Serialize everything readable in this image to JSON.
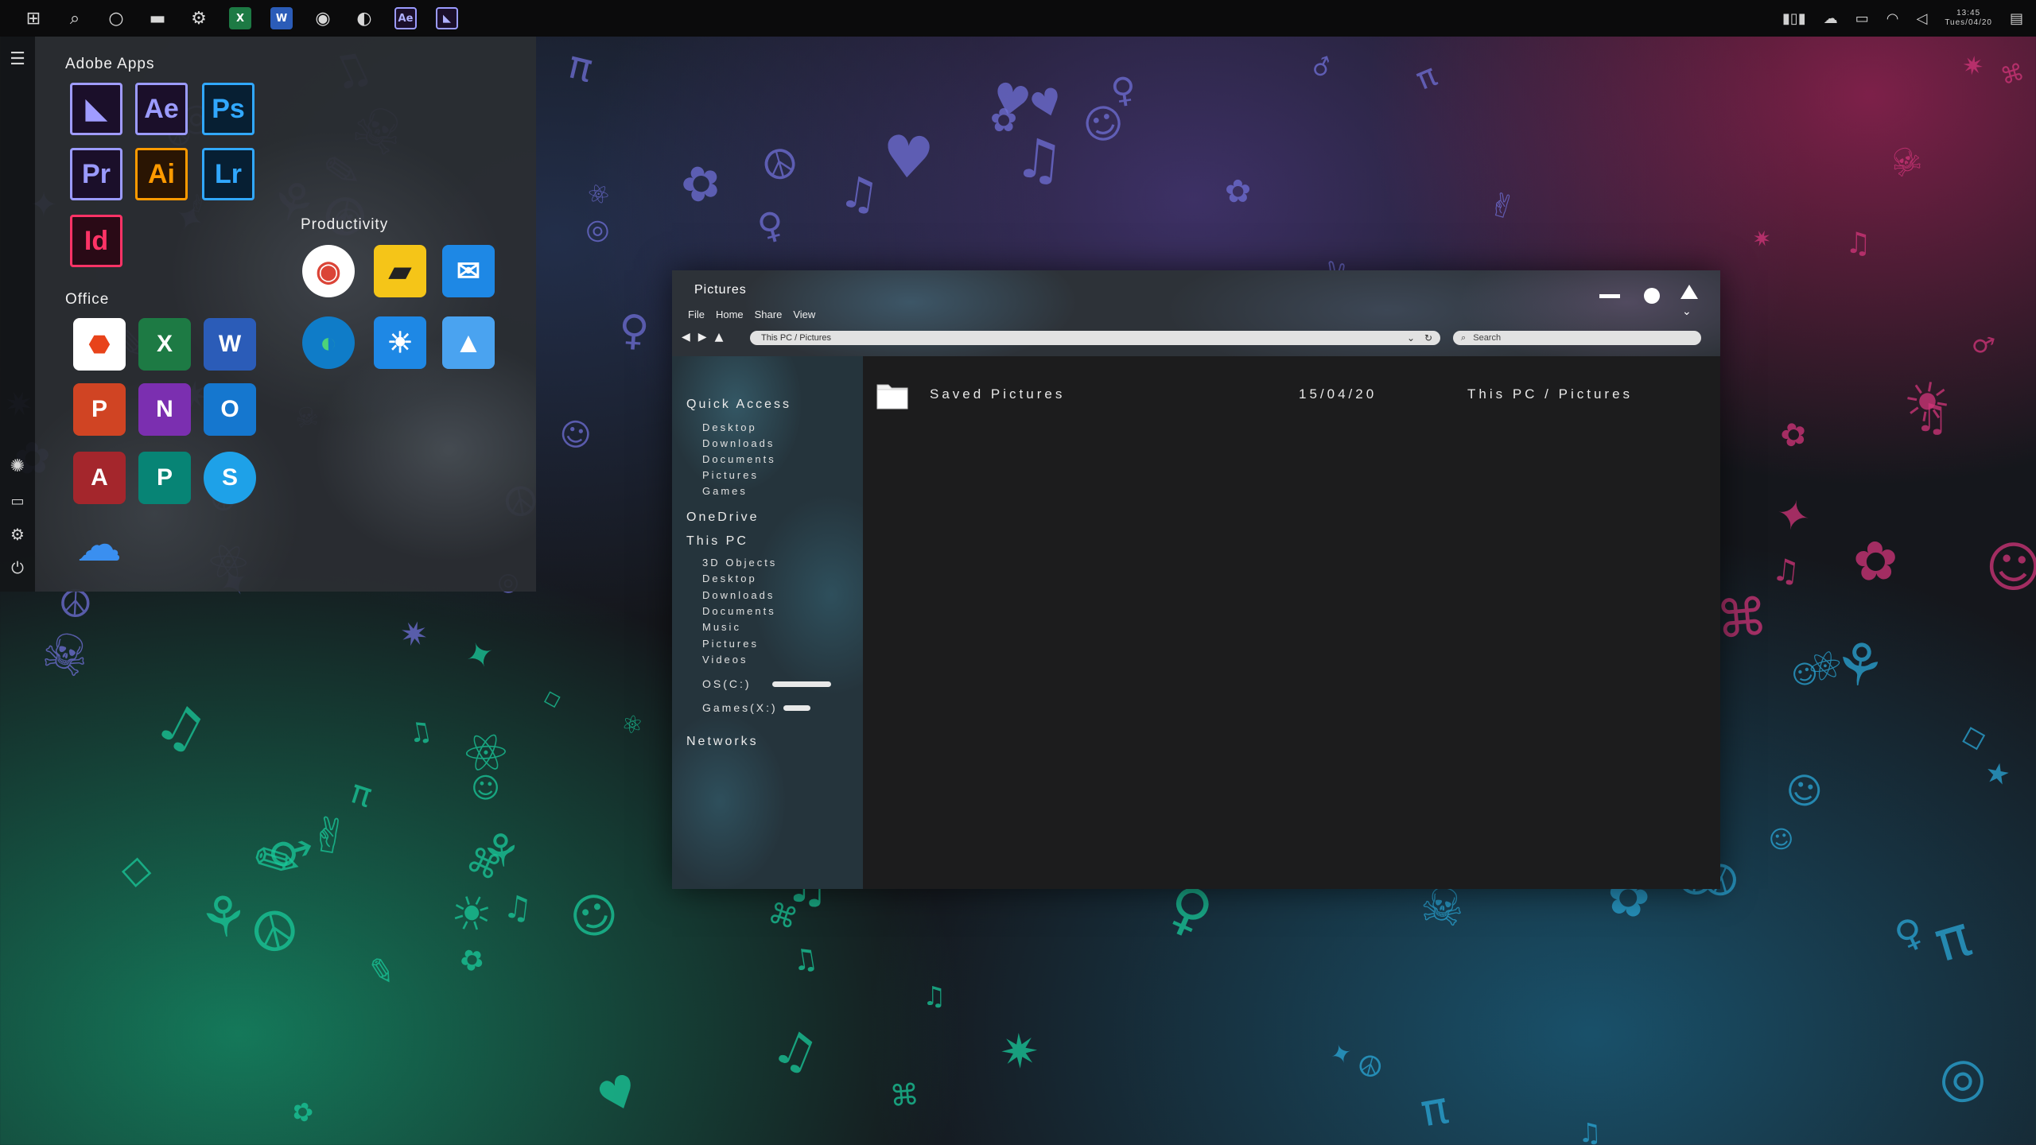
{
  "taskbar": {
    "pinned": [
      {
        "name": "windows-start-icon",
        "glyph": "⊞"
      },
      {
        "name": "search-icon",
        "glyph": "⌕"
      },
      {
        "name": "cortana-icon",
        "glyph": "○"
      },
      {
        "name": "file-explorer-icon",
        "glyph": "▬"
      },
      {
        "name": "settings-icon",
        "glyph": "⚙"
      },
      {
        "name": "excel-icon",
        "tile": "X",
        "color": "#1d7a44"
      },
      {
        "name": "word-icon",
        "tile": "W",
        "color": "#2b5cb8"
      },
      {
        "name": "chrome-icon",
        "glyph": "◉"
      },
      {
        "name": "app-icon",
        "glyph": "◐"
      },
      {
        "name": "after-effects-icon",
        "tile": "Ae",
        "color": "#1b0f2a"
      },
      {
        "name": "premiere-rush-icon",
        "tile": "◣",
        "color": "#1b0f2a"
      }
    ],
    "tray": {
      "clock_time": "13:45",
      "clock_date": "Tues/04/20"
    }
  },
  "start_menu": {
    "adobe_title": "Adobe Apps",
    "office_title": "Office",
    "productivity_title": "Productivity",
    "adobe_apps": [
      {
        "label": "◣",
        "name": "premiere-rush-tile",
        "color": "#a09cff"
      },
      {
        "label": "Ae",
        "name": "after-effects-tile",
        "color": "#9b9bff"
      },
      {
        "label": "Ps",
        "name": "photoshop-tile",
        "color": "#31a8ff"
      },
      {
        "label": "Pr",
        "name": "premiere-pro-tile",
        "color": "#9b9bff"
      },
      {
        "label": "Ai",
        "name": "illustrator-tile",
        "color": "#ff9a00"
      },
      {
        "label": "Lr",
        "name": "lightroom-tile",
        "color": "#31a8ff"
      },
      {
        "label": "Id",
        "name": "indesign-tile",
        "color": "#ff3366"
      }
    ],
    "office_apps": [
      {
        "label": "⬣",
        "name": "office-tile",
        "color": "#ffffff",
        "fg": "#e8431a"
      },
      {
        "label": "X",
        "name": "excel-tile",
        "color": "#1d7a44"
      },
      {
        "label": "W",
        "name": "word-tile",
        "color": "#2b5cb8"
      },
      {
        "label": "P",
        "name": "powerpoint-tile",
        "color": "#d04423"
      },
      {
        "label": "N",
        "name": "onenote-tile",
        "color": "#7b2fb0"
      },
      {
        "label": "O",
        "name": "outlook-tile",
        "color": "#1577cf"
      },
      {
        "label": "A",
        "name": "access-tile",
        "color": "#a4262c"
      },
      {
        "label": "P",
        "name": "publisher-tile",
        "color": "#078475"
      },
      {
        "label": "S",
        "name": "skype-tile",
        "color": "#1ea1e8"
      },
      {
        "label": "☁",
        "name": "onedrive-tile",
        "color": "#2b7de9"
      }
    ],
    "productivity_apps": [
      {
        "label": "◉",
        "name": "chrome-tile",
        "color": "#ffffff",
        "fg": "#db4437"
      },
      {
        "label": "▰",
        "name": "sticky-notes-tile",
        "color": "#f5c518",
        "fg": "#222222"
      },
      {
        "label": "✉",
        "name": "mail-tile",
        "color": "#1e88e5",
        "fg": "#ffffff"
      },
      {
        "label": "◐",
        "name": "edge-tile",
        "color": "#0f7cc8",
        "fg": "#4cd37a"
      },
      {
        "label": "☀",
        "name": "weather-tile",
        "color": "#1e88e5",
        "fg": "#ffffff"
      },
      {
        "label": "▲",
        "name": "photos-tile",
        "color": "#4aa3f0",
        "fg": "#ffffff"
      }
    ]
  },
  "explorer": {
    "title": "Pictures",
    "menu": [
      "File",
      "Home",
      "Share",
      "View"
    ],
    "address": "This PC / Pictures",
    "search_placeholder": "Search",
    "nav": {
      "quick_access": "Quick Access",
      "quick_items": [
        "Desktop",
        "Downloads",
        "Documents",
        "Pictures",
        "Games"
      ],
      "onedrive": "OneDrive",
      "this_pc": "This PC",
      "pc_items": [
        "3D Objects",
        "Desktop",
        "Downloads",
        "Documents",
        "Music",
        "Pictures",
        "Videos"
      ],
      "drives": [
        {
          "label": "OS(C:)",
          "used_fraction": 0.9
        },
        {
          "label": "Games(X:)",
          "used_fraction": 0.5
        }
      ],
      "networks": "Networks"
    },
    "files": [
      {
        "name": "Saved Pictures",
        "date": "15/04/20",
        "location": "This PC / Pictures"
      }
    ]
  }
}
